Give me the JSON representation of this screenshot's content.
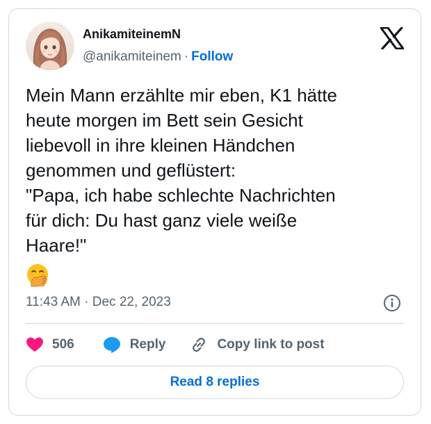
{
  "author": {
    "display_name": "AnikamiteinemN",
    "handle": "@anikamiteinem",
    "separator": "·",
    "follow_label": "Follow"
  },
  "tweet": {
    "lines": [
      "Mein Mann erzählte mir eben, K1 hätte",
      "heute morgen im Bett sein Gesicht",
      "liebevoll in ihre kleinen Händchen",
      "genommen und geflüstert:",
      "\"Papa, ich habe schlechte Nachrichten",
      "für dich: Du hast ganz viele weiße",
      "Haare!\""
    ],
    "emoji": "hand-over-mouth-emoji",
    "timestamp": "11:43 AM · Dec 22, 2023"
  },
  "actions": {
    "like_count": "506",
    "reply_label": "Reply",
    "copy_link_label": "Copy link to post"
  },
  "footer": {
    "read_replies_label": "Read 8 replies"
  },
  "colors": {
    "heart": "#f91880",
    "reply_bubble": "#1d9bf0",
    "link": "#006fd6",
    "secondary_text": "#536471",
    "border": "#cfd9de"
  },
  "icons": [
    "x-logo-icon",
    "info-icon",
    "heart-icon",
    "reply-bubble-icon",
    "link-icon"
  ]
}
